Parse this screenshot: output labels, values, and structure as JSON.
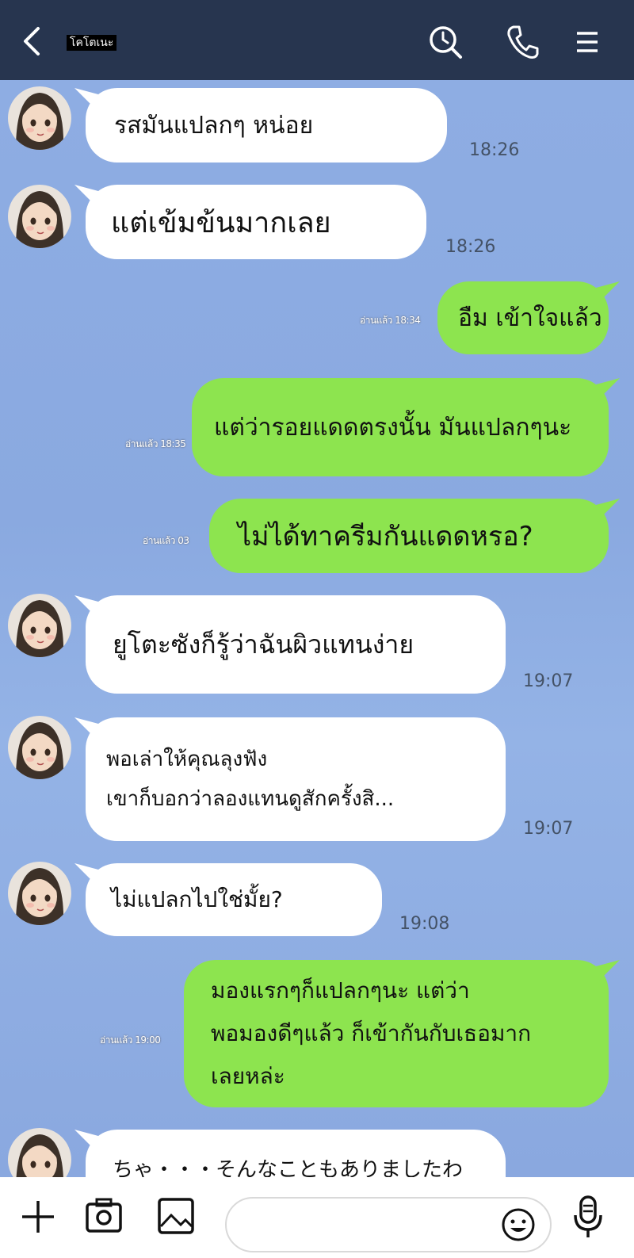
{
  "header": {
    "contact_name": "โคโตเนะ",
    "back_icon": "chevron-left-icon",
    "search_icon": "search-icon",
    "call_icon": "phone-icon",
    "menu_icon": "hamburger-menu-icon"
  },
  "messages": [
    {
      "side": "in",
      "text": "รสมันแปลกๆ หน่อย",
      "time": "18:26"
    },
    {
      "side": "in",
      "text": "แต่เข้มข้นมากเลย",
      "time": "18:26"
    },
    {
      "side": "out",
      "text": "อืม เข้าใจแล้ว",
      "read": "อ่านแล้ว 18:34"
    },
    {
      "side": "out",
      "text": "แต่ว่ารอยแดดตรงนั้น มันแปลกๆนะ",
      "read": "อ่านแล้ว 18:35"
    },
    {
      "side": "out",
      "text": "ไม่ได้ทาครีมกันแดดหรอ?",
      "read": "อ่านแล้ว 03"
    },
    {
      "side": "in",
      "text": "ยูโตะซังก็รู้ว่าฉันผิวแทนง่าย",
      "time": "19:07"
    },
    {
      "side": "in",
      "text": "พอเล่าให้คุณลุงฟัง\nเขาก็บอกว่าลองแทนดูสักครั้งสิ...",
      "time": "19:07"
    },
    {
      "side": "in",
      "text": "ไม่แปลกไปใช่มั้ย?",
      "time": "19:08"
    },
    {
      "side": "out",
      "text": "มองแรกๆก็แปลกๆนะ แต่ว่า\nพอมองดีๆแล้ว ก็เข้ากันกับเธอมาก\nเลยหล่ะ",
      "read": "อ่านแล้ว 19:00"
    },
    {
      "side": "in",
      "text": "ちゃ・・・そんなこともありましたわ"
    }
  ],
  "footer": {
    "input_value": "",
    "plus_icon": "plus-icon",
    "camera_icon": "camera-icon",
    "image_icon": "image-icon",
    "emoji_icon": "emoji-icon",
    "mic_icon": "microphone-icon"
  },
  "colors": {
    "header_bg": "#27354f",
    "chat_bg": "#8eaee2",
    "incoming_bubble": "#ffffff",
    "outgoing_bubble": "#8de44f"
  }
}
